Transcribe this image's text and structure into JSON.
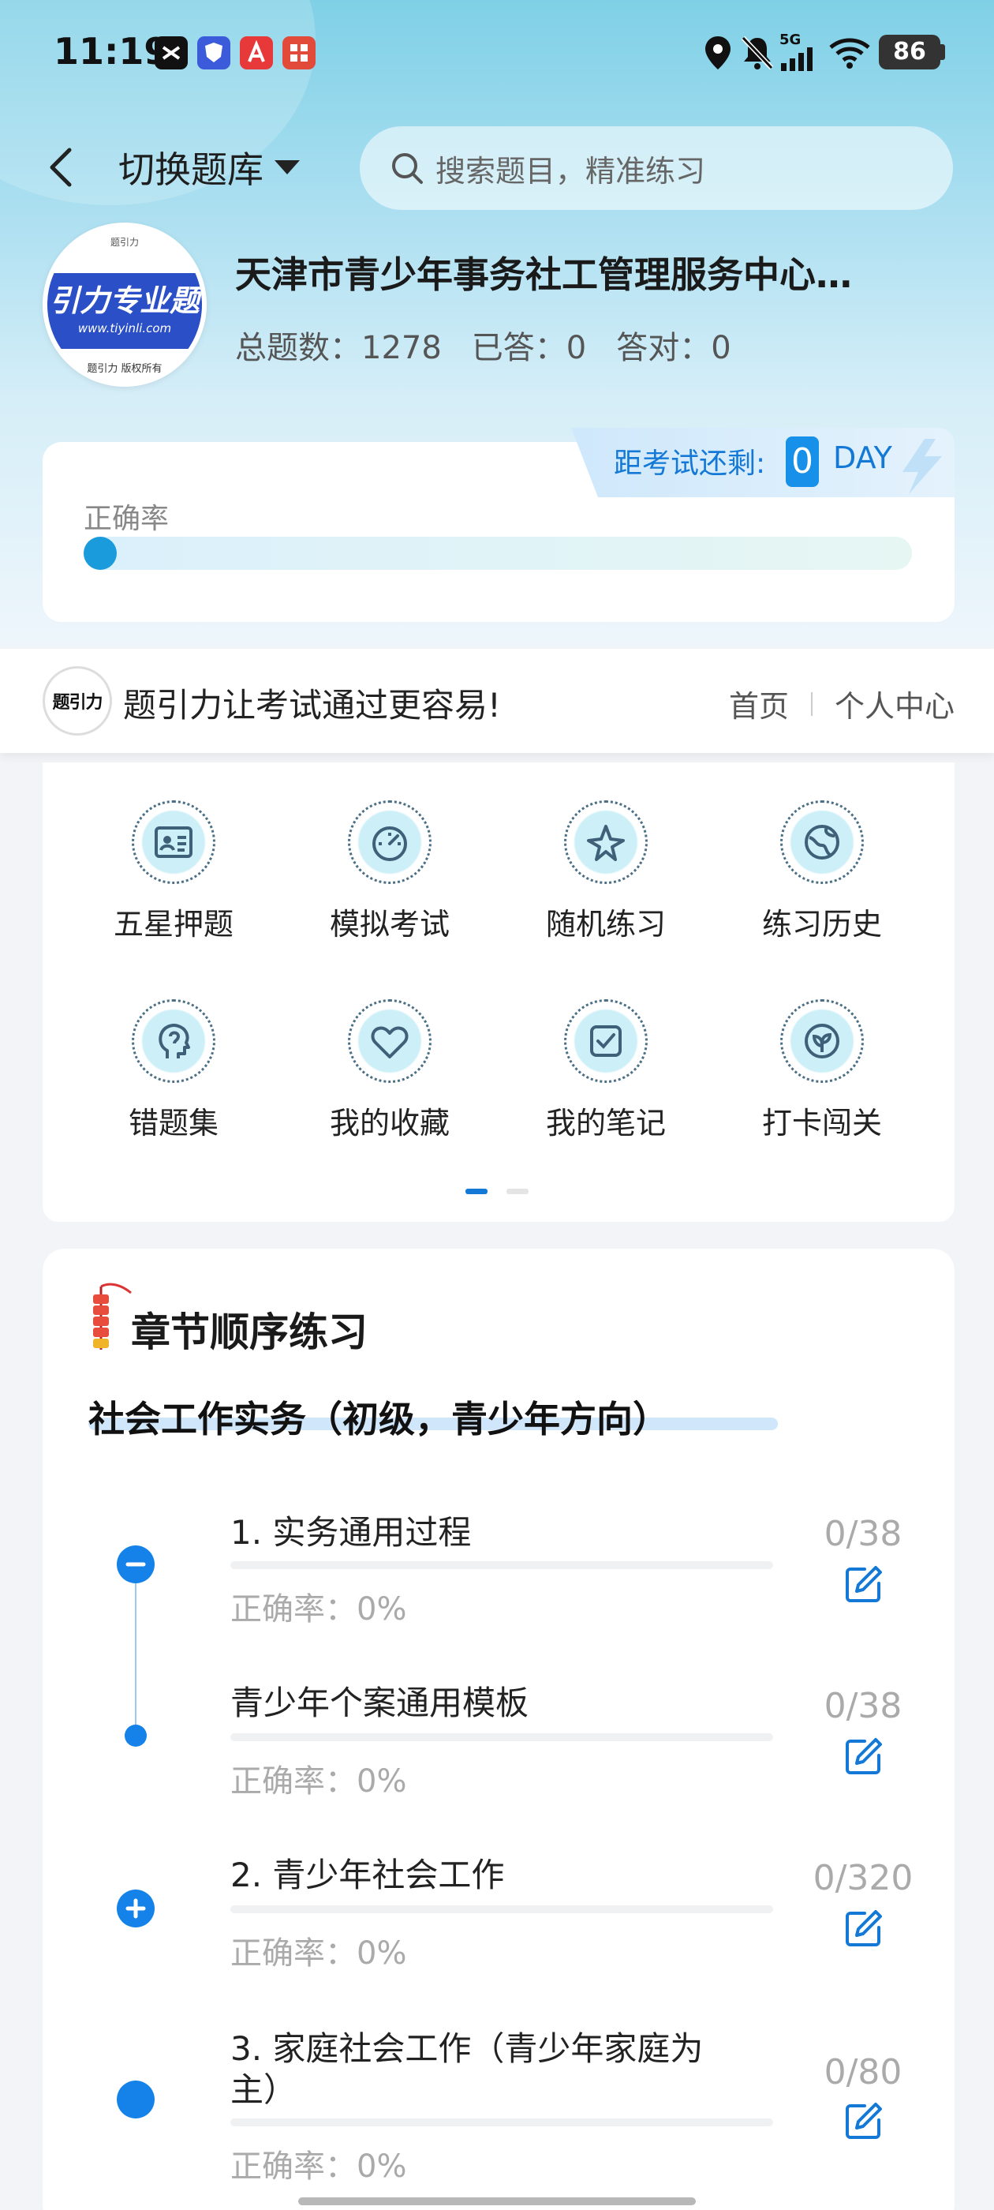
{
  "status_bar": {
    "time": "11:19",
    "network": "5G",
    "battery": "86",
    "app_icons": [
      "capcut-icon",
      "shield-app-icon",
      "red-a-app-icon",
      "red-grid-app-icon"
    ]
  },
  "nav": {
    "switch_label": "切换题库",
    "search_placeholder": "搜索题目，精准练习"
  },
  "bank": {
    "logo_top": "题引力",
    "logo_text": "引力专业题",
    "logo_url": "www.tiyinli.com",
    "logo_caption": "题引力 版权所有",
    "title": "天津市青少年事务社工管理服务中心…",
    "total_label": "总题数：",
    "total_value": "1278",
    "answered_label": "已答：",
    "answered_value": "0",
    "correct_label": "答对：",
    "correct_value": "0"
  },
  "accuracy": {
    "label": "正确率",
    "value_fraction": 0,
    "countdown_label": "距考试还剩:",
    "countdown_value": "0",
    "countdown_unit": "DAY"
  },
  "brand": {
    "logo_text": "题引力",
    "slogan": "题引力让考试通过更容易!",
    "nav_home": "首页",
    "nav_profile": "个人中心"
  },
  "functions": [
    {
      "label": "五星押题",
      "icon": "id-card-icon"
    },
    {
      "label": "模拟考试",
      "icon": "speedometer-icon"
    },
    {
      "label": "随机练习",
      "icon": "star-compass-icon"
    },
    {
      "label": "练习历史",
      "icon": "globe-icon"
    },
    {
      "label": "错题集",
      "icon": "head-profile-icon"
    },
    {
      "label": "我的收藏",
      "icon": "heart-icon"
    },
    {
      "label": "我的笔记",
      "icon": "checkbox-icon"
    },
    {
      "label": "打卡闯关",
      "icon": "leaf-icon"
    }
  ],
  "pager": {
    "pages": 2,
    "active": 1
  },
  "chapters_section": {
    "title": "章节顺序练习",
    "subject": "社会工作实务（初级，青少年方向）",
    "accuracy_label": "正确率：",
    "items": [
      {
        "name": "1. 实务通用过程",
        "accuracy": "0%",
        "count": "0/38",
        "node": "collapse"
      },
      {
        "name": "青少年个案通用模板",
        "accuracy": "0%",
        "count": "0/38",
        "node": "child"
      },
      {
        "name": "2. 青少年社会工作",
        "accuracy": "0%",
        "count": "0/320",
        "node": "expand"
      },
      {
        "name": "3. 家庭社会工作（青少年家庭为",
        "name2": "主）",
        "accuracy": "0%",
        "count": "0/80",
        "node": "leaf"
      }
    ]
  },
  "colors": {
    "accent": "#1482e8",
    "countdown_text": "#1479d6",
    "hero_top": "#7fd0e6"
  }
}
